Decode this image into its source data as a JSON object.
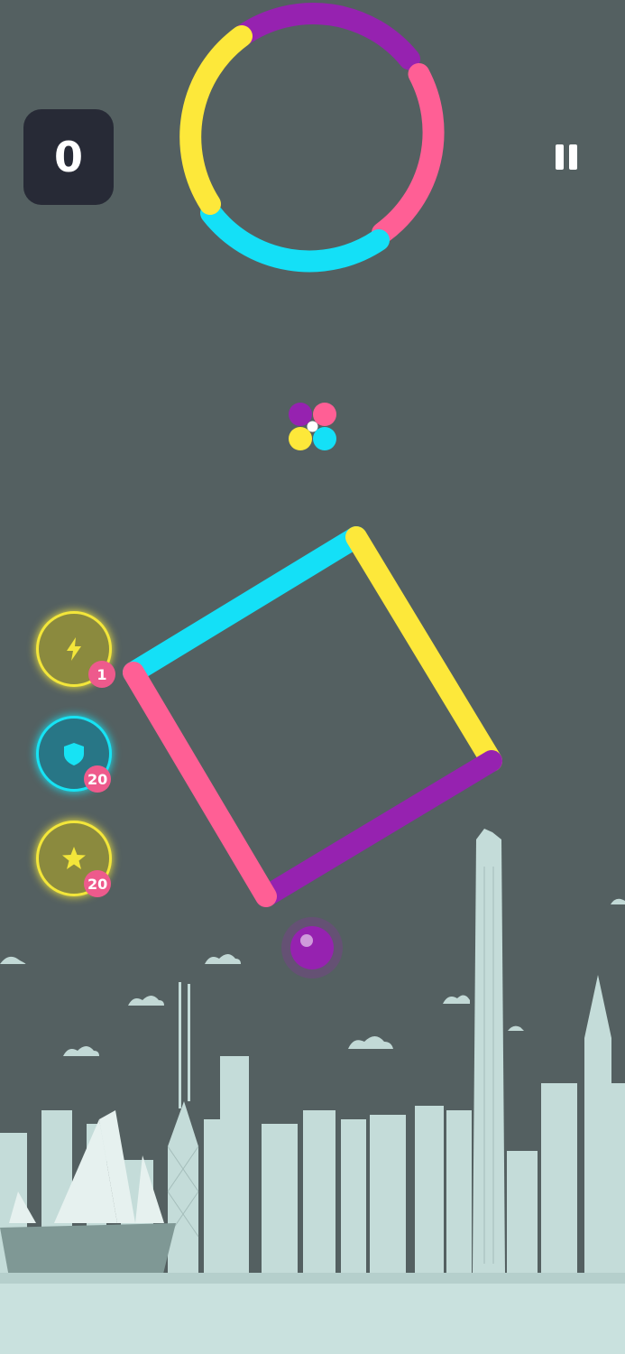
{
  "hud": {
    "score": "0"
  },
  "powerups": [
    {
      "name": "lightning-powerup",
      "icon": "lightning-icon",
      "count": "1",
      "fill": "#8b8a3e",
      "border": "#f3e63a"
    },
    {
      "name": "shield-powerup",
      "icon": "shield-icon",
      "count": "20",
      "fill": "#287686",
      "border": "#17e3f4"
    },
    {
      "name": "star-powerup",
      "icon": "star-icon",
      "count": "20",
      "fill": "#8b8a3e",
      "border": "#f3e63a"
    }
  ],
  "colors": {
    "purple": "#9622b0",
    "pink": "#ff5f95",
    "yellow": "#fde83a",
    "cyan": "#14e0f7",
    "background": "#546061",
    "skyline": "#c9e1de"
  },
  "player": {
    "color": "purple"
  },
  "obstacles": {
    "ring": [
      "purple",
      "pink",
      "cyan",
      "yellow"
    ],
    "square": [
      "cyan",
      "yellow",
      "purple",
      "pink"
    ]
  },
  "color_switcher": [
    "purple",
    "pink",
    "yellow",
    "cyan"
  ]
}
